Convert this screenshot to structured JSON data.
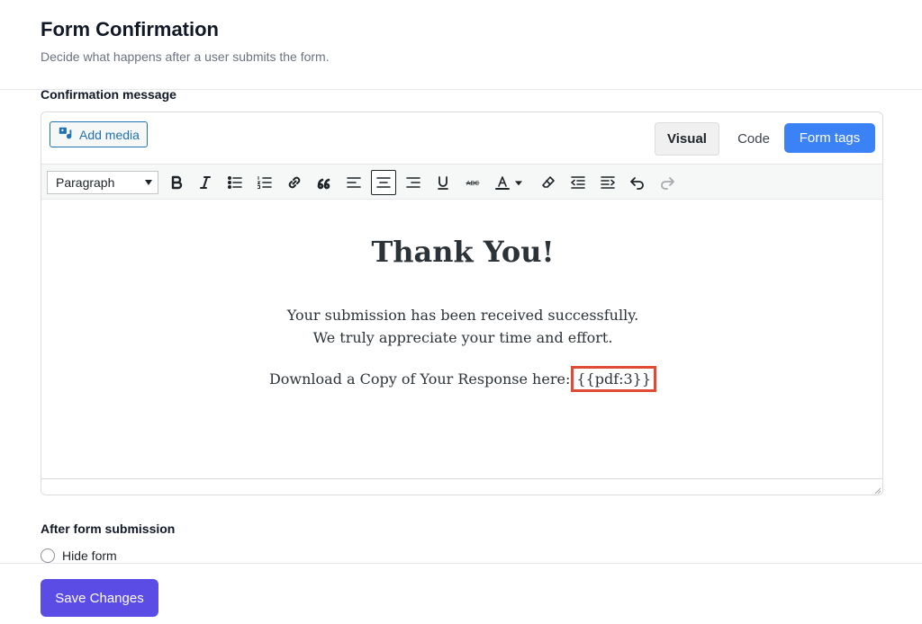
{
  "header": {
    "title": "Form Confirmation",
    "subtitle": "Decide what happens after a user submits the form."
  },
  "confirmation": {
    "label": "Confirmation message",
    "add_media_label": "Add media",
    "tabs": {
      "visual": "Visual",
      "code": "Code",
      "form_tags": "Form tags"
    },
    "toolbar": {
      "format_value": "Paragraph",
      "buttons": [
        "bold",
        "italic",
        "bulleted-list",
        "numbered-list",
        "link",
        "blockquote",
        "align-left",
        "align-center",
        "align-right",
        "underline",
        "strikethrough",
        "text-color",
        "clear-formatting",
        "outdent",
        "indent",
        "undo",
        "redo"
      ],
      "active_button": "align-center"
    },
    "content": {
      "heading": "Thank You!",
      "line1": "Your submission has been received successfully.",
      "line2": "We truly appreciate your time and effort.",
      "line3_prefix": "Download a Copy of Your Response here:",
      "pdf_tag": "{{pdf:3}}"
    }
  },
  "after_submission": {
    "label": "After form submission",
    "options": [
      {
        "label": "Hide form",
        "selected": false
      }
    ]
  },
  "footer": {
    "save_label": "Save Changes"
  },
  "colors": {
    "accent_primary": "#5b4ce6",
    "form_tags_button": "#3b82f6",
    "highlight_box": "#e04b36",
    "link_blue": "#2271b1"
  }
}
